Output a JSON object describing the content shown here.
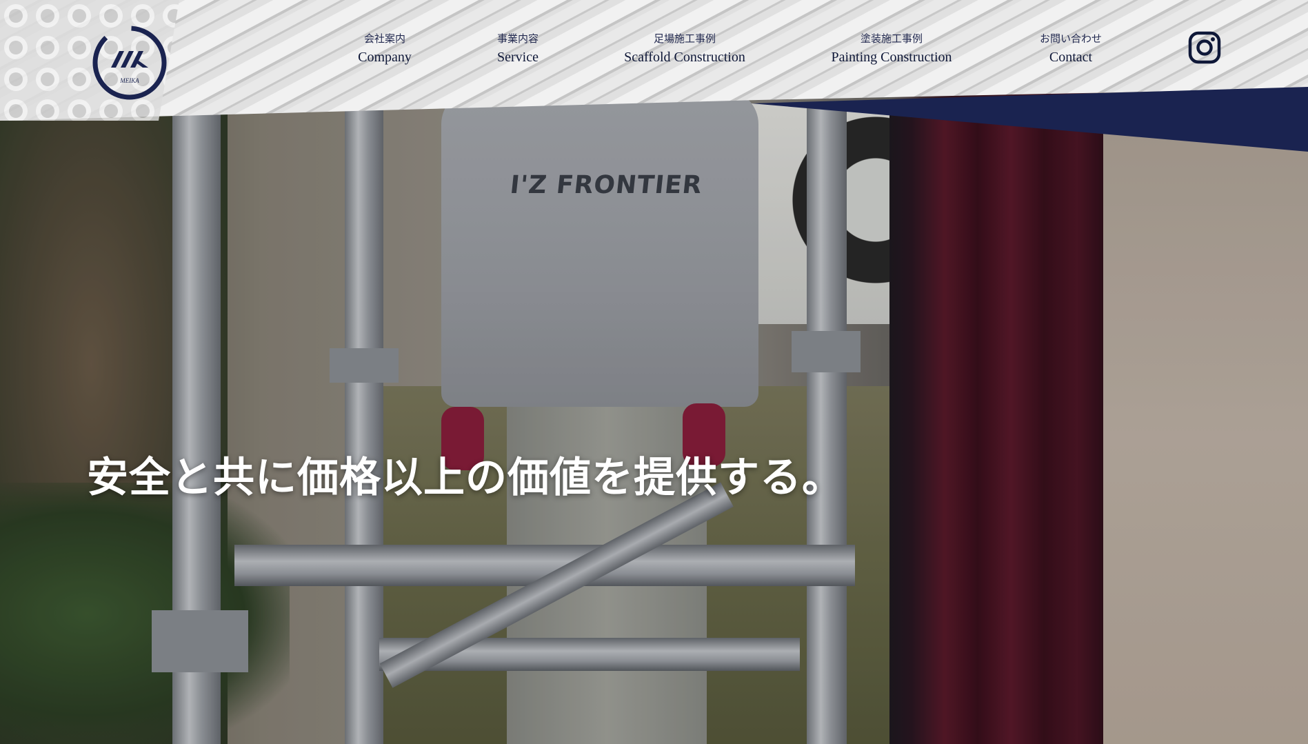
{
  "brand": {
    "name": "MEIKA",
    "logo_mark": "MK"
  },
  "nav": {
    "items": [
      {
        "ja": "会社案内",
        "en": "Company"
      },
      {
        "ja": "事業内容",
        "en": "Service"
      },
      {
        "ja": "足場施工事例",
        "en": "Scaffold Construction"
      },
      {
        "ja": "塗装施工事例",
        "en": "Painting Construction"
      },
      {
        "ja": "お問い合わせ",
        "en": "Contact"
      }
    ]
  },
  "social": {
    "icon": "instagram-icon"
  },
  "hero": {
    "tagline": "安全と共に価格以上の価値を提供する。",
    "shirt_print": "I'Z FRONTIER"
  },
  "colors": {
    "navy": "#1a2350",
    "text_dark": "#0f1838",
    "tagline": "#ffffff"
  }
}
